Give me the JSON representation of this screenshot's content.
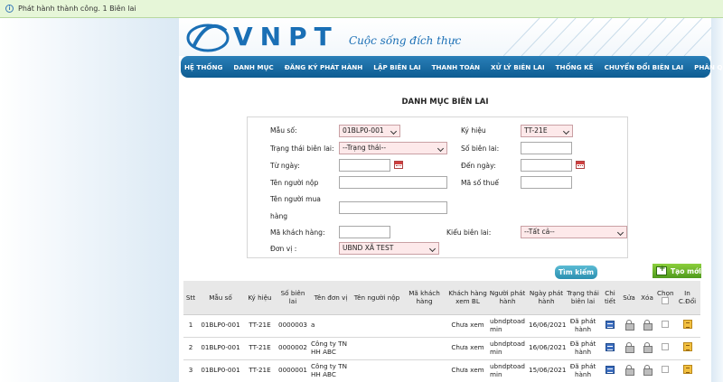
{
  "notification": {
    "message": "Phát hành thành công. 1 Biên lai",
    "icon": "info-icon"
  },
  "brand": {
    "logo": "VNPT",
    "slogan": "Cuộc sống đích thực",
    "color": "#1a6fb5"
  },
  "menu": [
    "HỆ THỐNG",
    "DANH MỤC",
    "ĐĂNG KÝ PHÁT HÀNH",
    "LẬP BIÊN LAI",
    "THANH TOÁN",
    "XỬ LÝ BIÊN LAI",
    "THỐNG KÊ",
    "CHUYỂN ĐỔI BIÊN LAI",
    "PHÂN QUYỀN"
  ],
  "page_title": "DANH MỤC BIÊN LAI",
  "form": {
    "mau_so": {
      "label": "Mẫu số:",
      "value": "01BLP0-001"
    },
    "ky_hieu": {
      "label": "Ký hiệu",
      "value": "TT-21E"
    },
    "trang_thai": {
      "label": "Trạng thái biên lai:",
      "value": "--Trạng thái--"
    },
    "so_bien_lai": {
      "label": "Số biên lai:",
      "value": ""
    },
    "tu_ngay": {
      "label": "Từ ngày:",
      "value": ""
    },
    "den_ngay": {
      "label": "Đến ngày:",
      "value": ""
    },
    "ten_nguoi_nop": {
      "label": "Tên người nộp",
      "value": ""
    },
    "ma_so_thue": {
      "label": "Mã số thuế",
      "value": ""
    },
    "ten_nguoi_mua_hang": {
      "label_line1": "Tên người mua",
      "label_line2": "hàng",
      "value": ""
    },
    "ma_khach_hang": {
      "label": "Mã khách hàng:",
      "value": ""
    },
    "kieu_bien_lai": {
      "label": "Kiểu biên lai:",
      "value": "--Tất cả--"
    },
    "don_vi": {
      "label": "Đơn vị :",
      "value": "UBND XÃ TEST"
    }
  },
  "buttons": {
    "search": "Tìm kiếm",
    "create": "Tạo mới"
  },
  "table": {
    "headers": [
      "Stt",
      "Mẫu số",
      "Ký hiệu",
      "Số biên lai",
      "Tên đơn vị",
      "Tên người nộp",
      "Mã khách hàng",
      "Khách hàng xem BL",
      "Người phát hành",
      "Ngày phát hành",
      "Trạng thái biên lai",
      "Chi tiết",
      "Sửa",
      "Xóa",
      "Chọn",
      "In C.Đổi"
    ],
    "rows": [
      {
        "stt": "1",
        "mau_so": "01BLP0-001",
        "ky_hieu": "TT-21E",
        "so_bl": "0000003",
        "don_vi": "a",
        "nguoi_nop": "",
        "ma_kh": "",
        "kh_xem": "Chưa xem",
        "nguoi_ph": "ubndptoad min",
        "ngay_ph": "16/06/2021",
        "trang_thai": "Đã phát hành"
      },
      {
        "stt": "2",
        "mau_so": "01BLP0-001",
        "ky_hieu": "TT-21E",
        "so_bl": "0000002",
        "don_vi": "Công ty TN HH ABC",
        "nguoi_nop": "",
        "ma_kh": "",
        "kh_xem": "Chưa xem",
        "nguoi_ph": "ubndptoad min",
        "ngay_ph": "16/06/2021",
        "trang_thai": "Đã phát hành"
      },
      {
        "stt": "3",
        "mau_so": "01BLP0-001",
        "ky_hieu": "TT-21E",
        "so_bl": "0000001",
        "don_vi": "Công ty TN HH ABC",
        "nguoi_nop": "",
        "ma_kh": "",
        "kh_xem": "Chưa xem",
        "nguoi_ph": "ubndptoad min",
        "ngay_ph": "15/06/2021",
        "trang_thai": "Đã phát hành"
      }
    ]
  }
}
